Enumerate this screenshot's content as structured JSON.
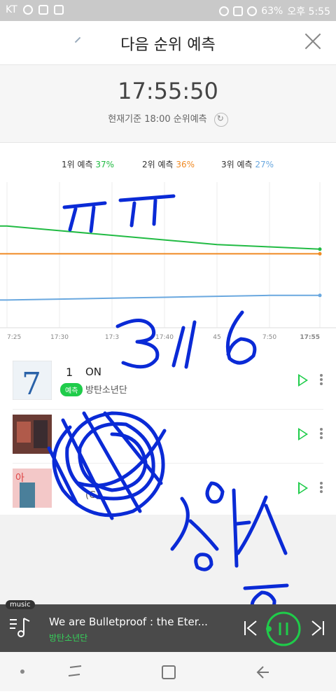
{
  "status_bar": {
    "carrier": "KT",
    "battery": "63%",
    "time": "오후 5:55"
  },
  "header": {
    "title": "다음 순위 예측"
  },
  "timer": {
    "time": "17:55:50",
    "basis": "현재기준 18:00 순위예측"
  },
  "chart_data": {
    "type": "line",
    "title": "",
    "legend": [
      {
        "label": "1위 예측",
        "pct": "37%",
        "color": "#22bb44"
      },
      {
        "label": "2위 예측",
        "pct": "36%",
        "color": "#f08a24"
      },
      {
        "label": "3위 예측",
        "pct": "27%",
        "color": "#6aa8df"
      }
    ],
    "x": [
      "17:25",
      "17:30",
      "17:35",
      "17:40",
      "17:45",
      "17:50",
      "17:55"
    ],
    "x_tick_labels": [
      "7:25",
      "17:30",
      "17:3",
      "17:40",
      "45",
      "7:50",
      "17:55"
    ],
    "series": [
      {
        "name": "1위 예측",
        "values": [
          42,
          41,
          40,
          39,
          38,
          37.5,
          37
        ]
      },
      {
        "name": "2위 예측",
        "values": [
          36,
          36,
          36,
          36,
          36,
          36,
          36
        ]
      },
      {
        "name": "3위 예측",
        "values": [
          26,
          26.2,
          26.4,
          26.6,
          26.8,
          27,
          27
        ]
      }
    ],
    "ylim": [
      0,
      100
    ],
    "grid": true
  },
  "rows": [
    {
      "rank": "1",
      "song": "ON",
      "badge": "예측",
      "artist": "방탄소년단"
    },
    {
      "rank": "",
      "song": "",
      "badge": "",
      "artist": ""
    },
    {
      "rank": "",
      "song": "",
      "badge": "",
      "artist": "(G)"
    }
  ],
  "player": {
    "tag": "music",
    "title": "We are Bulletproof : the Eter...",
    "artist": "방탄소년단"
  },
  "annotations": {
    "top": "ㅠㅠ",
    "middle": "3시6",
    "bottom": "상승"
  },
  "colors": {
    "accent": "#1fcc4a",
    "scribble": "#0a2ad6"
  }
}
